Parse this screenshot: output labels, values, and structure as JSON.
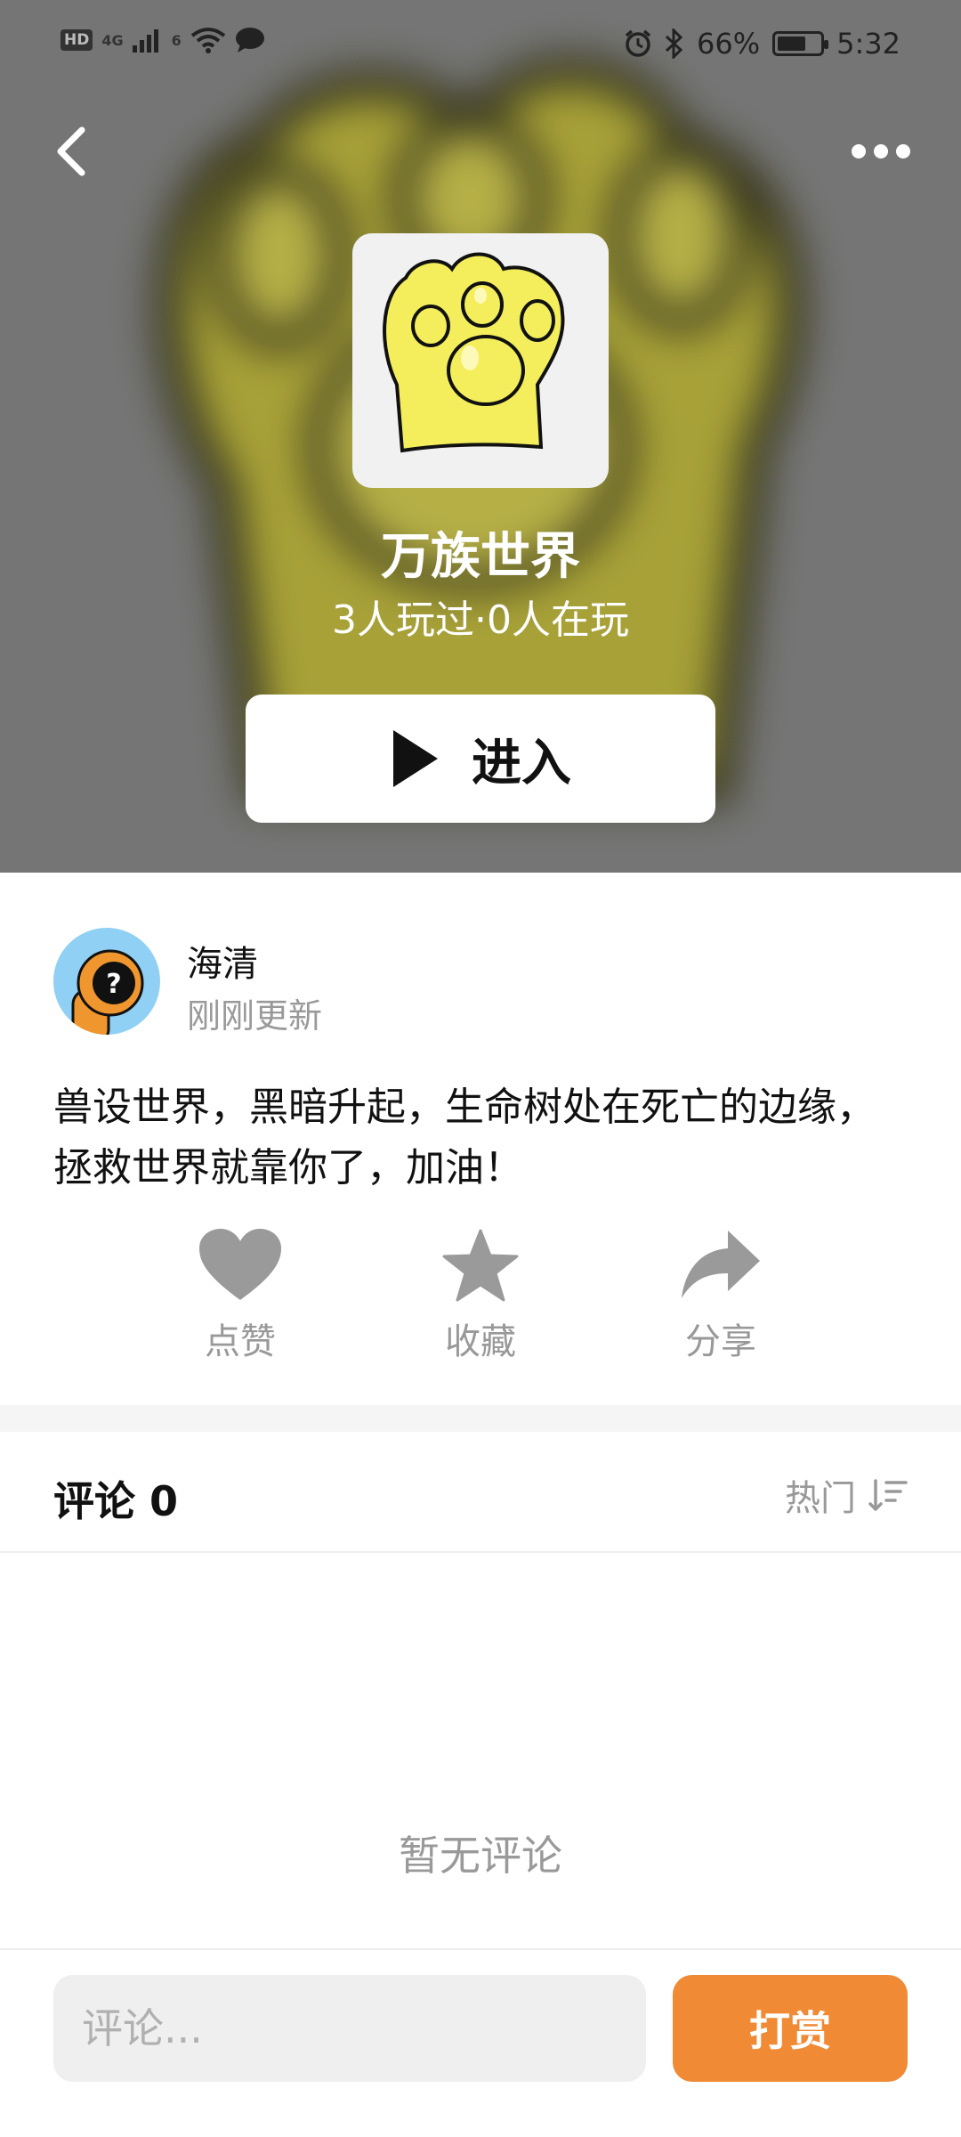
{
  "status_bar": {
    "left_badge": "HD",
    "network": "4G",
    "wifi_badge": "6",
    "battery": "66%",
    "time": "5:32"
  },
  "game": {
    "title": "万族世界",
    "stats": "3人玩过·0人在玩",
    "enter_label": "进入"
  },
  "author": {
    "name": "海清",
    "updated": "刚刚更新"
  },
  "description": "兽设世界，黑暗升起，生命树处在死亡的边缘，拯救世界就靠你了，加油！",
  "actions": {
    "like": "点赞",
    "favorite": "收藏",
    "share": "分享"
  },
  "comments": {
    "title": "评论 0",
    "sort_label": "热门",
    "empty_text": "暂无评论"
  },
  "bottom_bar": {
    "input_placeholder": "评论...",
    "tip_label": "打赏"
  },
  "colors": {
    "hero_background": "#7f7f7f",
    "paw_yellow": "#f4ee5c",
    "accent_orange": "#f08a34",
    "avatar_blue": "#8fd0f4",
    "muted_text": "#999999"
  },
  "icons": {
    "back": "chevron-left-icon",
    "more": "more-dots-icon",
    "play": "play-icon",
    "like": "heart-icon",
    "favorite": "star-icon",
    "share": "share-arrow-icon",
    "sort": "sort-icon"
  }
}
